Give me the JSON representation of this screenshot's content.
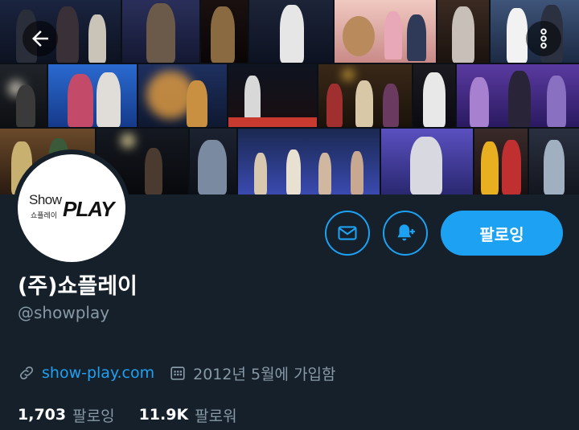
{
  "profile": {
    "display_name": "(주)쇼플레이",
    "handle": "@showplay",
    "website": "show-play.com",
    "joined": "2012년 5월에 가입함",
    "avatar_logo": {
      "show": "Show",
      "korean": "쇼플레이",
      "play": "PLAY"
    }
  },
  "actions": {
    "follow_label": "팔로잉",
    "message_icon": "mail-icon",
    "notify_icon": "bell-plus-icon"
  },
  "stats": {
    "following_count": "1,703",
    "following_label": "팔로잉",
    "followers_count": "11.9K",
    "followers_label": "팔로워"
  },
  "header": {
    "back_icon": "back-arrow-icon",
    "more_icon": "more-vertical-icon"
  },
  "colors": {
    "background": "#15202b",
    "accent": "#1da1f2",
    "secondary_text": "#8899a6"
  }
}
